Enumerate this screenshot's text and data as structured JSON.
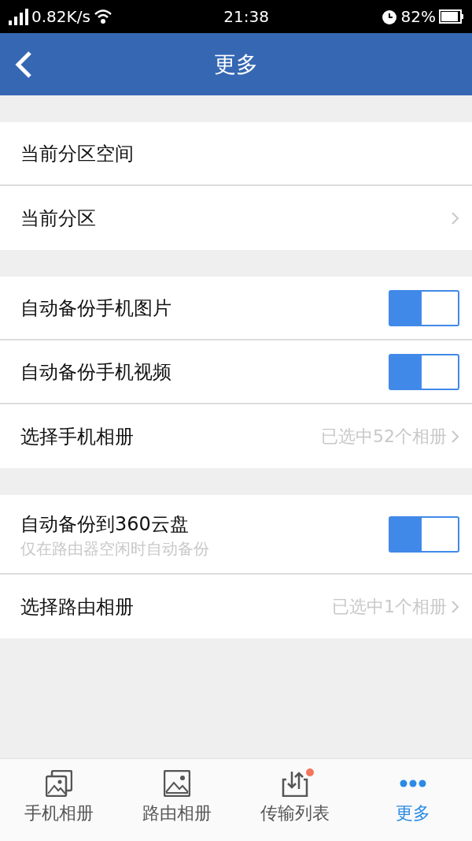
{
  "status_bar": {
    "speed": "0.82K/s",
    "time": "21:38",
    "battery": "82%"
  },
  "header": {
    "title": "更多"
  },
  "sections": [
    {
      "rows": [
        {
          "kind": "info",
          "label": "当前分区空间"
        },
        {
          "kind": "link",
          "label": "当前分区"
        }
      ]
    },
    {
      "rows": [
        {
          "kind": "toggle",
          "label": "自动备份手机图片",
          "on": true
        },
        {
          "kind": "toggle",
          "label": "自动备份手机视频",
          "on": true
        },
        {
          "kind": "link",
          "label": "选择手机相册",
          "value": "已选中52个相册"
        }
      ]
    },
    {
      "rows": [
        {
          "kind": "toggle",
          "label": "自动备份到360云盘",
          "hint": "仅在路由器空闲时自动备份",
          "on": true
        },
        {
          "kind": "link",
          "label": "选择路由相册",
          "value": "已选中1个相册"
        }
      ]
    }
  ],
  "tab_bar": [
    {
      "label": "手机相册",
      "selected": false,
      "badge": false
    },
    {
      "label": "路由相册",
      "selected": false,
      "badge": false
    },
    {
      "label": "传输列表",
      "selected": false,
      "badge": true
    },
    {
      "label": "更多",
      "selected": true,
      "badge": false
    }
  ]
}
